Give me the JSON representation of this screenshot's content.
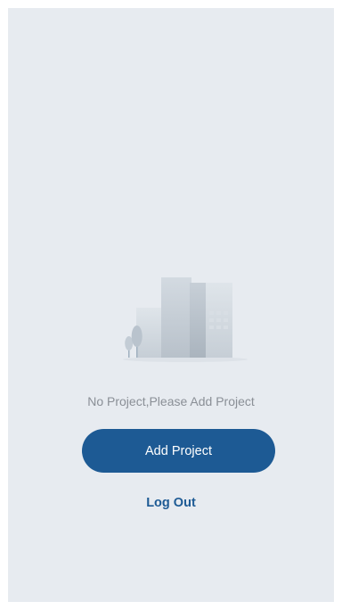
{
  "empty_state": {
    "illustration_icon": "buildings-illustration",
    "message": "No Project,Please Add Project"
  },
  "actions": {
    "add_project_label": "Add Project",
    "log_out_label": "Log Out"
  },
  "colors": {
    "background": "#e7ebf0",
    "primary": "#1d5a94",
    "muted_text": "#8a8f96"
  }
}
